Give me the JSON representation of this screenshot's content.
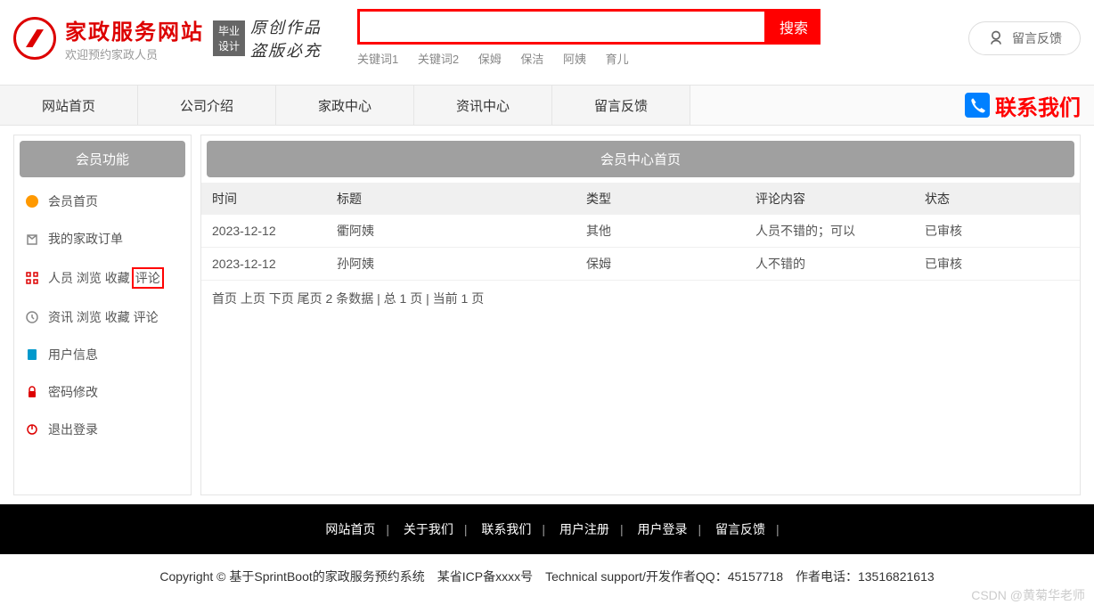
{
  "header": {
    "logo_title": "家政服务网站",
    "logo_sub": "欢迎预约家政人员",
    "badge_line1": "毕业",
    "badge_line2": "设计",
    "script_line1": "原创作品",
    "script_line2": "盗版必充",
    "search_btn": "搜索",
    "keywords": [
      "关键词1",
      "关键词2",
      "保姆",
      "保洁",
      "阿姨",
      "育儿"
    ],
    "feedback_label": "留言反馈"
  },
  "nav": {
    "items": [
      "网站首页",
      "公司介绍",
      "家政中心",
      "资讯中心",
      "留言反馈"
    ],
    "contact": "联系我们"
  },
  "sidebar": {
    "title": "会员功能",
    "items": [
      {
        "label": "会员首页",
        "icon": "home",
        "color": "#f90"
      },
      {
        "label": "我的家政订单",
        "icon": "order",
        "color": "#888"
      },
      {
        "label_pre": "人员 浏览 收藏",
        "label_hl": "评论",
        "icon": "grid",
        "color": "#d00"
      },
      {
        "label": "资讯 浏览 收藏 评论",
        "icon": "clock",
        "color": "#888"
      },
      {
        "label": "用户信息",
        "icon": "doc",
        "color": "#09c"
      },
      {
        "label": "密码修改",
        "icon": "lock",
        "color": "#d00"
      },
      {
        "label": "退出登录",
        "icon": "power",
        "color": "#d00"
      }
    ]
  },
  "content": {
    "title": "会员中心首页",
    "headers": {
      "time": "时间",
      "title": "标题",
      "type": "类型",
      "comment": "评论内容",
      "status": "状态"
    },
    "rows": [
      {
        "time": "2023-12-12",
        "title": "衢阿姨",
        "type": "其他",
        "comment": "人员不错的；可以",
        "status": "已审核"
      },
      {
        "time": "2023-12-12",
        "title": "孙阿姨",
        "type": "保姆",
        "comment": "人不错的",
        "status": "已审核"
      }
    ],
    "pagination": "首页 上页 下页 尾页 2 条数据 | 总 1 页 | 当前 1 页"
  },
  "footer": {
    "links": [
      "网站首页",
      "关于我们",
      "联系我们",
      "用户注册",
      "用户登录",
      "留言反馈"
    ],
    "copyright": "Copyright © 基于SprintBoot的家政服务预约系统　某省ICP备xxxx号　Technical support/开发作者QQ：45157718　作者电话：13516821613"
  },
  "watermark": "CSDN @黄菊华老师"
}
